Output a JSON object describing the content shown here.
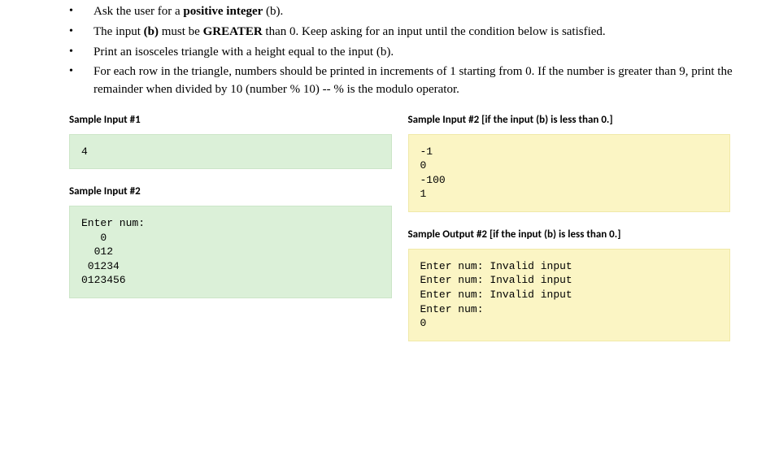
{
  "bullets": [
    {
      "parts": [
        {
          "text": "Ask the user for a ",
          "bold": false
        },
        {
          "text": "positive integer",
          "bold": true
        },
        {
          "text": " (b).",
          "bold": false
        }
      ]
    },
    {
      "parts": [
        {
          "text": "The input ",
          "bold": false
        },
        {
          "text": "(b)",
          "bold": true
        },
        {
          "text": " must be ",
          "bold": false
        },
        {
          "text": "GREATER",
          "bold": true
        },
        {
          "text": " than 0. Keep asking for an input until the condition below is satisfied.",
          "bold": false
        }
      ]
    },
    {
      "parts": [
        {
          "text": "Print an isosceles triangle with a height equal to the input (b).",
          "bold": false
        }
      ]
    },
    {
      "parts": [
        {
          "text": "For each row in the triangle, numbers should be printed in increments of 1 starting from 0. If the number is greater than 9, print the remainder when divided by 10 (number % 10) -- % is the modulo operator.",
          "bold": false
        }
      ]
    }
  ],
  "left": {
    "heading1": "Sample Input #1",
    "code1": "4",
    "heading2": "Sample Input #2",
    "code2": "Enter num:\n   0\n  012\n 01234\n0123456"
  },
  "right": {
    "heading1": "Sample Input #2   [if the input (b) is less than 0.]",
    "code1": "-1\n0\n-100\n1",
    "heading2": "Sample Output #2   [if the input (b) is less than 0.]",
    "code2": "Enter num: Invalid input\nEnter num: Invalid input\nEnter num: Invalid input\nEnter num:\n0"
  }
}
